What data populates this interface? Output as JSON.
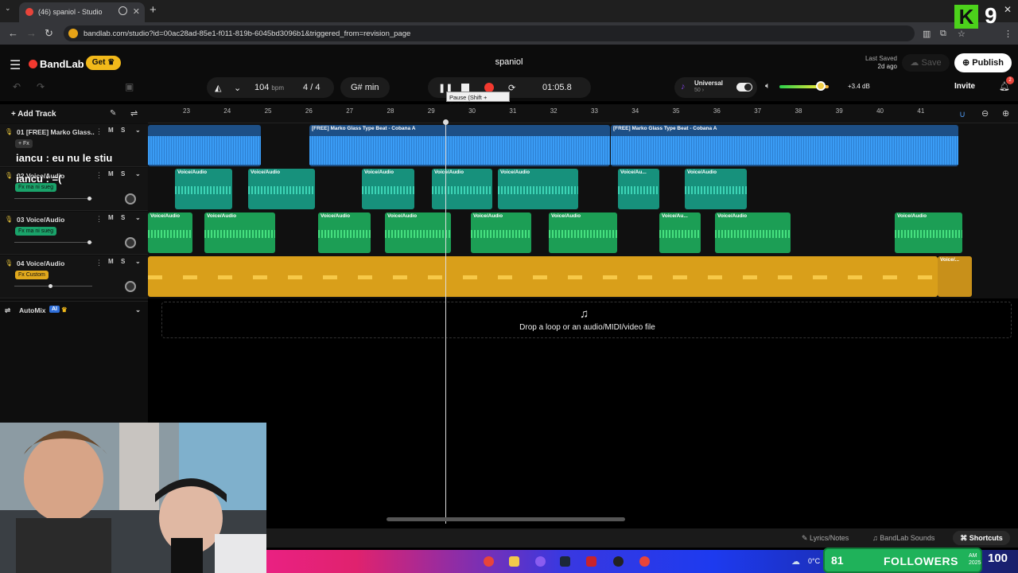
{
  "browser": {
    "tab_title": "(46) spaniol - Studio",
    "url": "bandlab.com/studio?id=00ac28ad-85e1-f011-819b-6045bd3096b1&triggered_from=revision_page",
    "overlay_number": "9"
  },
  "header": {
    "logo": "BandLab",
    "get_label": "Get",
    "project_title": "spaniol",
    "last_saved_label": "Last Saved",
    "last_saved_time": "2d ago",
    "save_label": "Save",
    "publish_label": "Publish"
  },
  "toolbar": {
    "bpm_value": "104",
    "bpm_unit": "bpm",
    "time_sig_num": "4",
    "time_sig_sep": "/",
    "time_sig_den": "4",
    "key": "G# min",
    "time": "01:05.8",
    "tooltip": "Pause (Shift + Space)",
    "preset_name": "Universal",
    "preset_sub": "50 ›",
    "volume_db": "+3.4 dB",
    "invite_label": "Invite",
    "bell_count": "2"
  },
  "tracks_panel": {
    "add_track_label": "Add Track",
    "tracks": [
      {
        "name": "01  [FREE] Marko Glass...",
        "fx": "+ Fx",
        "mute": "M",
        "solo": "S"
      },
      {
        "name": "02  Voice/Audio",
        "fx": "Fx ma ni sueg",
        "mute": "M",
        "solo": "S"
      },
      {
        "name": "03  Voice/Audio",
        "fx": "Fx ma ni sueg",
        "mute": "M",
        "solo": "S"
      },
      {
        "name": "04  Voice/Audio",
        "fx": "Fx Custom",
        "mute": "M",
        "solo": "S"
      }
    ],
    "automix_label": "AutoMix",
    "automix_badge": "AI"
  },
  "chat_overlay": {
    "line1": "iancu : eu nu le stiu",
    "line2": "iancu : =("
  },
  "timeline": {
    "bars": [
      "23",
      "24",
      "25",
      "26",
      "27",
      "28",
      "29",
      "30",
      "31",
      "32",
      "33",
      "34",
      "35",
      "36",
      "37",
      "38",
      "39",
      "40",
      "41"
    ],
    "clip_labels": {
      "beat_a": "[FREE] Marko Glass Type Beat - Cobana  A",
      "beat_b": "[FREE] Marko Glass Type Beat - Cobana  A",
      "voice": "Voice/Audio",
      "voice_short": "Voice/Au...",
      "voice_end": "Voice/..."
    },
    "drop_text": "Drop a loop or an audio/MIDI/video file"
  },
  "footer": {
    "lyrics_label": "Lyrics/Notes",
    "sounds_label": "BandLab Sounds",
    "shortcuts_label": "Shortcuts"
  },
  "taskbar": {
    "temperature": "0°C",
    "followers_count": "81",
    "followers_label": "FOLLOWERS",
    "count_right": "100",
    "clock_time": "AM",
    "clock_year": "2025"
  },
  "colors": {
    "beat_clip": "#2f86d9",
    "voice2_clip": "#1aa38a",
    "voice3_clip": "#22b26a",
    "voice4_clip": "#e0a81c",
    "record": "#f2392f"
  }
}
